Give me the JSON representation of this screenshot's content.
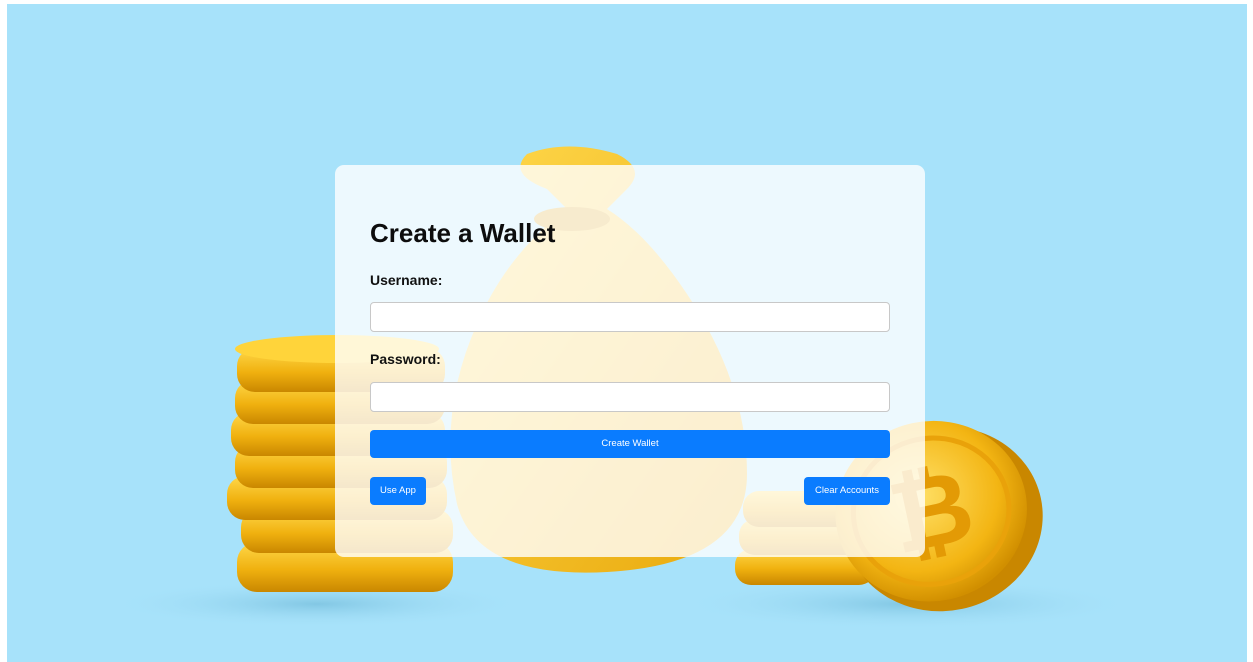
{
  "page": {
    "title": "Create a Wallet"
  },
  "form": {
    "username_label": "Username:",
    "username_value": "",
    "password_label": "Password:",
    "password_value": ""
  },
  "actions": {
    "create_wallet": "Create Wallet",
    "use_app": "Use App",
    "clear_accounts": "Clear Accounts"
  },
  "colors": {
    "background": "#a7e2fa",
    "button": "#0a7cff",
    "coin_gold": "#f2b611",
    "bag": "#f7dd8c"
  },
  "icons": {
    "background_art": "gold-coins-money-bag-illustration"
  }
}
